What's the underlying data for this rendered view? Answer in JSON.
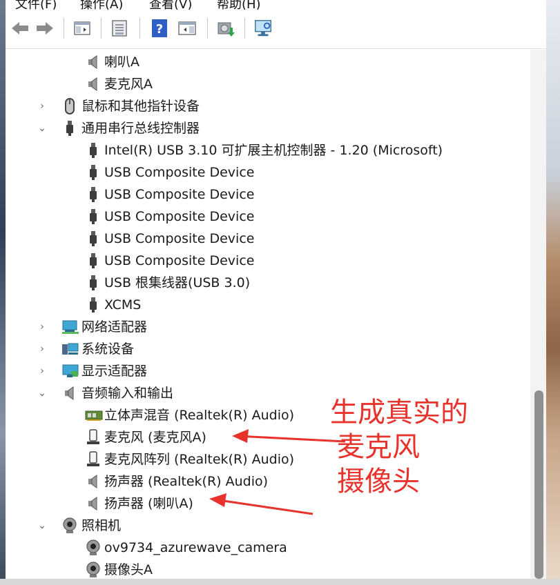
{
  "menu": {
    "file": "文件(F)",
    "action": "操作(A)",
    "view": "查看(V)",
    "help": "帮助(H)"
  },
  "toolbar": {
    "icons": [
      "back-icon",
      "forward-icon",
      "show-hide-console-tree-icon",
      "properties-icon",
      "help-icon",
      "action-pane-icon",
      "update-driver-icon",
      "scan-hardware-icon"
    ]
  },
  "tree": {
    "speaker_a": "喇叭A",
    "mic_a": "麦克风A",
    "mice": "鼠标和其他指针设备",
    "usb_controllers": "通用串行总线控制器",
    "usb_items": [
      "Intel(R) USB 3.10 可扩展主机控制器 - 1.20 (Microsoft)",
      "USB Composite Device",
      "USB Composite Device",
      "USB Composite Device",
      "USB Composite Device",
      "USB Composite Device",
      "USB 根集线器(USB 3.0)",
      "XCMS"
    ],
    "network": "网络适配器",
    "system": "系统设备",
    "display": "显示适配器",
    "audio_io": "音频输入和输出",
    "audio_items": [
      "立体声混音 (Realtek(R) Audio)",
      "麦克风 (麦克风A)",
      "麦克风阵列 (Realtek(R) Audio)",
      "扬声器 (Realtek(R) Audio)",
      "扬声器 (喇叭A)"
    ],
    "camera": "照相机",
    "camera_items": [
      "ov9734_azurewave_camera",
      "摄像头A"
    ]
  },
  "annotation": {
    "line1": "生成真实的",
    "line2": "麦克风",
    "line3": "摄像头",
    "color": "#e8322c"
  }
}
